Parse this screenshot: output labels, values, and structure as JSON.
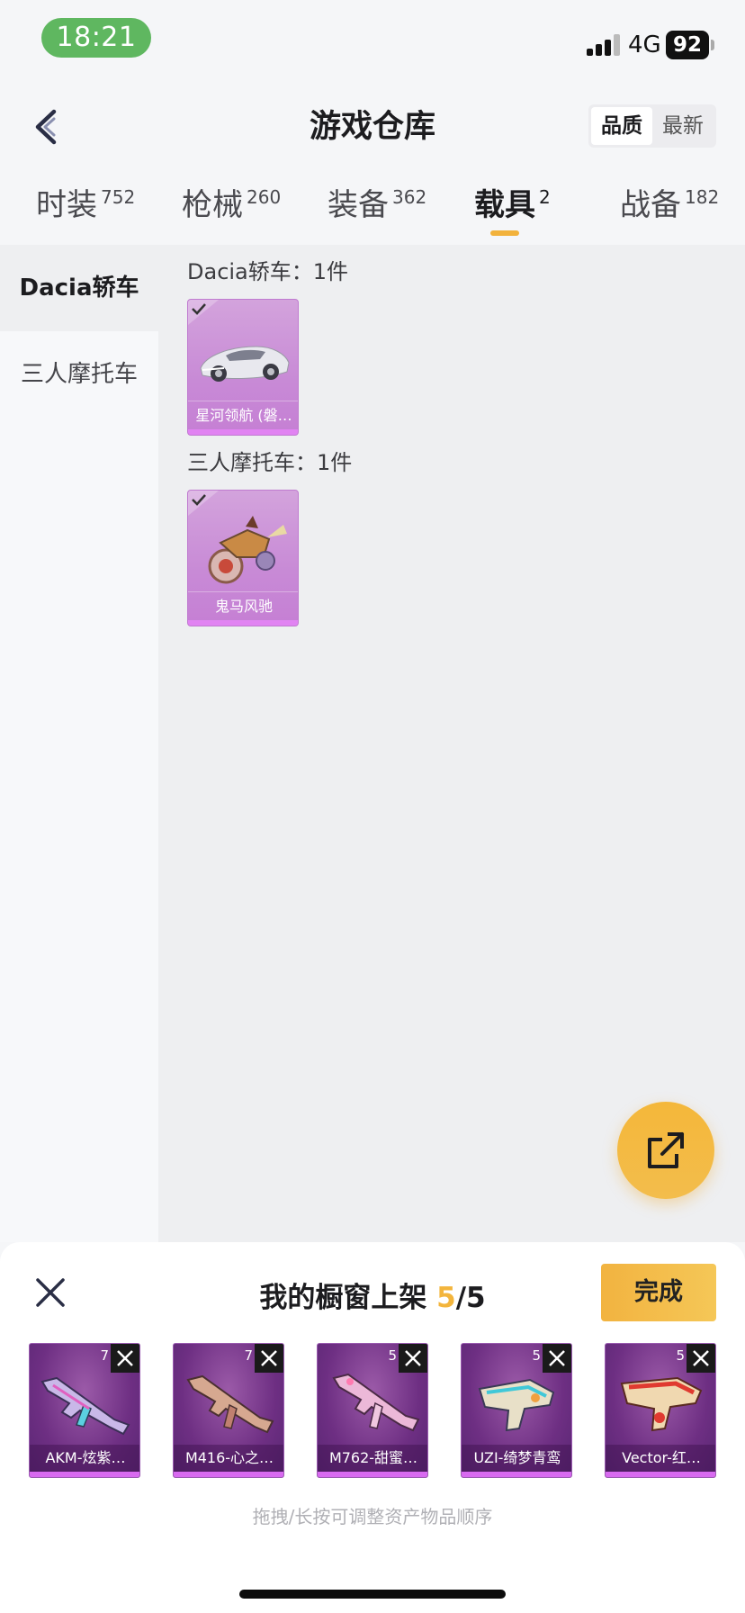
{
  "status_bar": {
    "time": "18:21",
    "network": "4G",
    "battery": "92"
  },
  "header": {
    "title": "游戏仓库",
    "sort_options": [
      "品质",
      "最新"
    ],
    "sort_active": "品质"
  },
  "tabs": [
    {
      "label": "时装",
      "count": "752"
    },
    {
      "label": "枪械",
      "count": "260"
    },
    {
      "label": "装备",
      "count": "362"
    },
    {
      "label": "载具",
      "count": "2",
      "active": true
    },
    {
      "label": "战备",
      "count": "182"
    }
  ],
  "side_nav": [
    {
      "label": "Dacia轿车",
      "active": true
    },
    {
      "label": "三人摩托车"
    }
  ],
  "sections": [
    {
      "title": "Dacia轿车：1件",
      "items": [
        {
          "name": "星河领航 (磐…",
          "icon": "sports-car-icon",
          "checked": true
        }
      ]
    },
    {
      "title": "三人摩托车：1件",
      "items": [
        {
          "name": "鬼马风驰",
          "icon": "motorcycle-icon",
          "checked": true
        }
      ]
    }
  ],
  "sheet": {
    "title_prefix": "我的橱窗上架 ",
    "count_current": "5",
    "count_total": "/5",
    "done_label": "完成",
    "hint": "拖拽/长按可调整资产物品顺序",
    "items": [
      {
        "name": "AKM-炫紫…",
        "level": "7",
        "icon": "rifle-icon"
      },
      {
        "name": "M416-心之…",
        "level": "7",
        "icon": "rifle-icon"
      },
      {
        "name": "M762-甜蜜…",
        "level": "5",
        "icon": "rifle-icon"
      },
      {
        "name": "UZI-绮梦青鸾",
        "level": "5",
        "icon": "smg-icon"
      },
      {
        "name": "Vector-红…",
        "level": "5",
        "icon": "smg-icon"
      }
    ]
  },
  "colors": {
    "accent": "#f3b53c",
    "rarity_purple": "#c88ad6",
    "status_green": "#5fb760"
  }
}
